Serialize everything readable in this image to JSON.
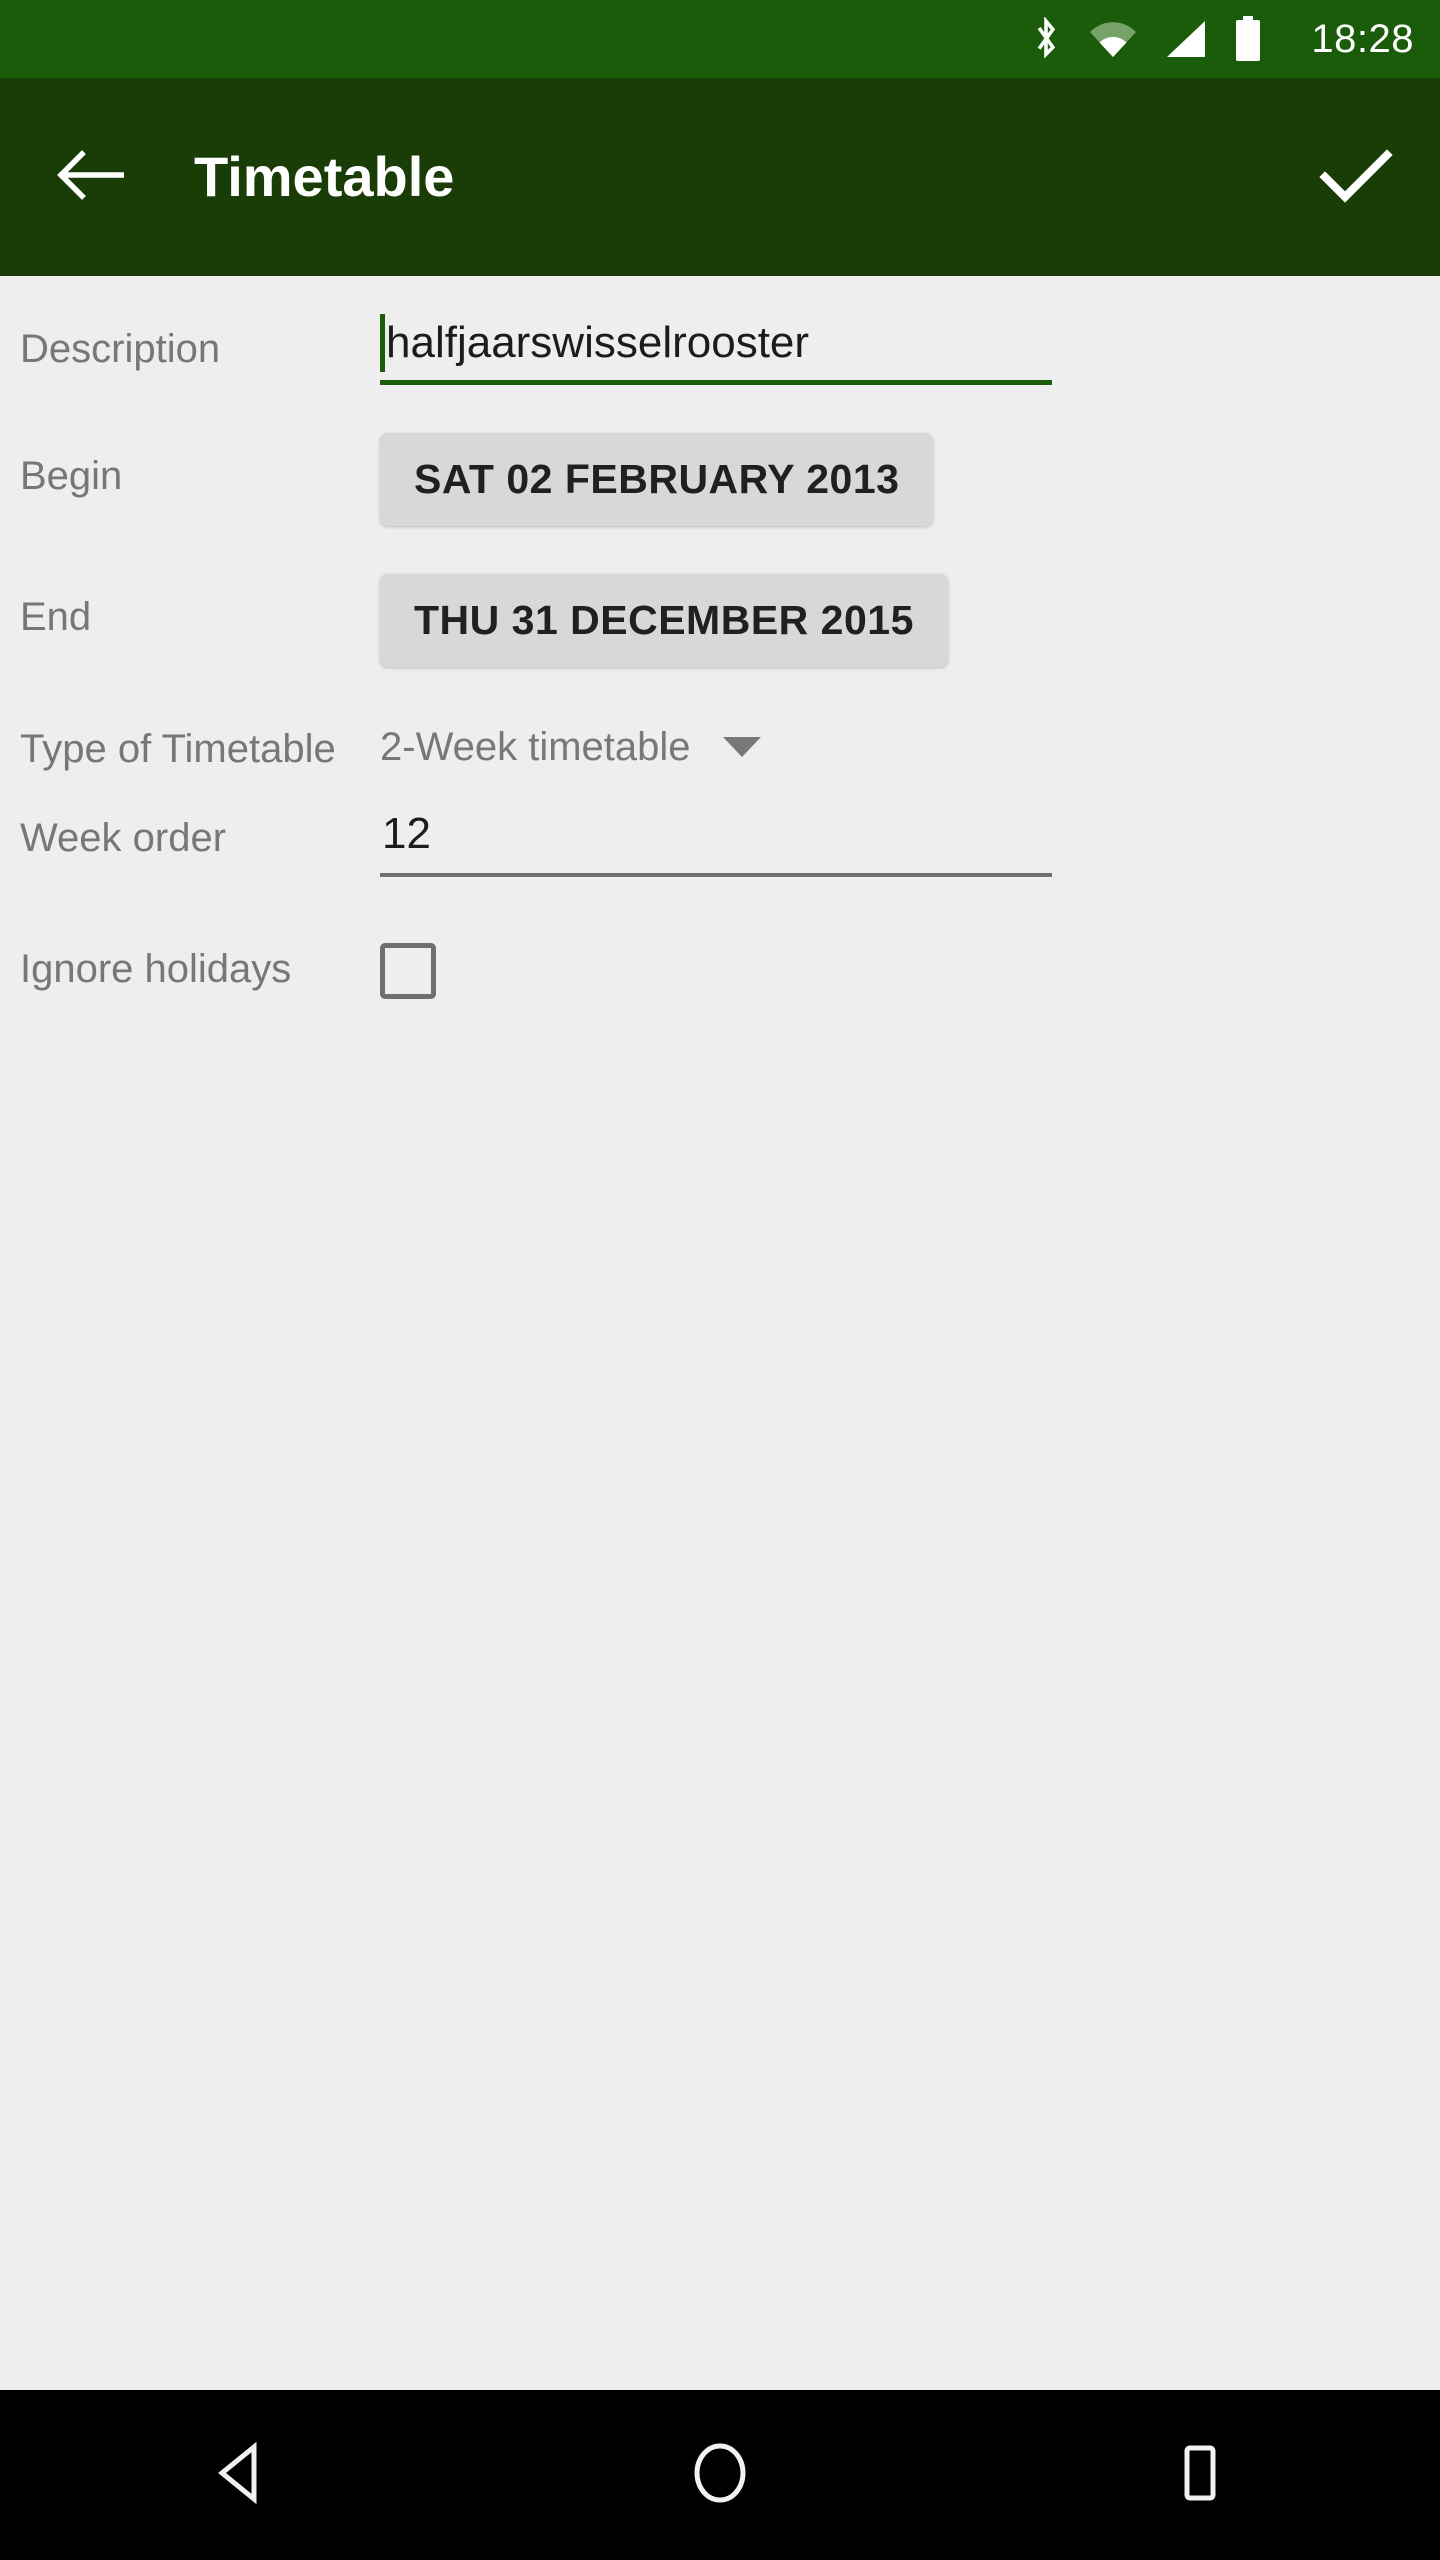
{
  "status_bar": {
    "time": "18:28",
    "icons": [
      "bluetooth-icon",
      "wifi-icon",
      "cellular-signal-icon",
      "battery-icon"
    ],
    "background_color": "#1a5c0a",
    "foreground_color": "#ffffff"
  },
  "app_bar": {
    "title": "Timetable",
    "back_icon": "arrow-left-icon",
    "confirm_icon": "check-icon",
    "background_color": "#1a3d08",
    "foreground_color": "#ffffff"
  },
  "form": {
    "description": {
      "label": "Description",
      "value": "halfjaarswisselrooster",
      "placeholder": "",
      "focused": true,
      "underline_color": "#1a5c0a",
      "caret_color": "#1a5c0a"
    },
    "begin": {
      "label": "Begin",
      "value": "SAT 02 FEBRUARY 2013"
    },
    "end": {
      "label": "End",
      "value": "THU 31 DECEMBER 2015"
    },
    "type_of_timetable": {
      "label": "Type of Timetable",
      "value": "2-Week timetable",
      "arrow_icon": "chevron-down-icon"
    },
    "week_order": {
      "label": "Week order",
      "value": "12",
      "placeholder": "",
      "underline_color": "#6f6f6f"
    },
    "ignore_holidays": {
      "label": "Ignore holidays",
      "checked": false
    }
  },
  "nav_bar": {
    "background_color": "#000000",
    "buttons": [
      {
        "name": "back-nav-button",
        "icon": "triangle-back-icon"
      },
      {
        "name": "home-nav-button",
        "icon": "circle-home-icon"
      },
      {
        "name": "recents-nav-button",
        "icon": "square-recents-icon"
      }
    ]
  }
}
